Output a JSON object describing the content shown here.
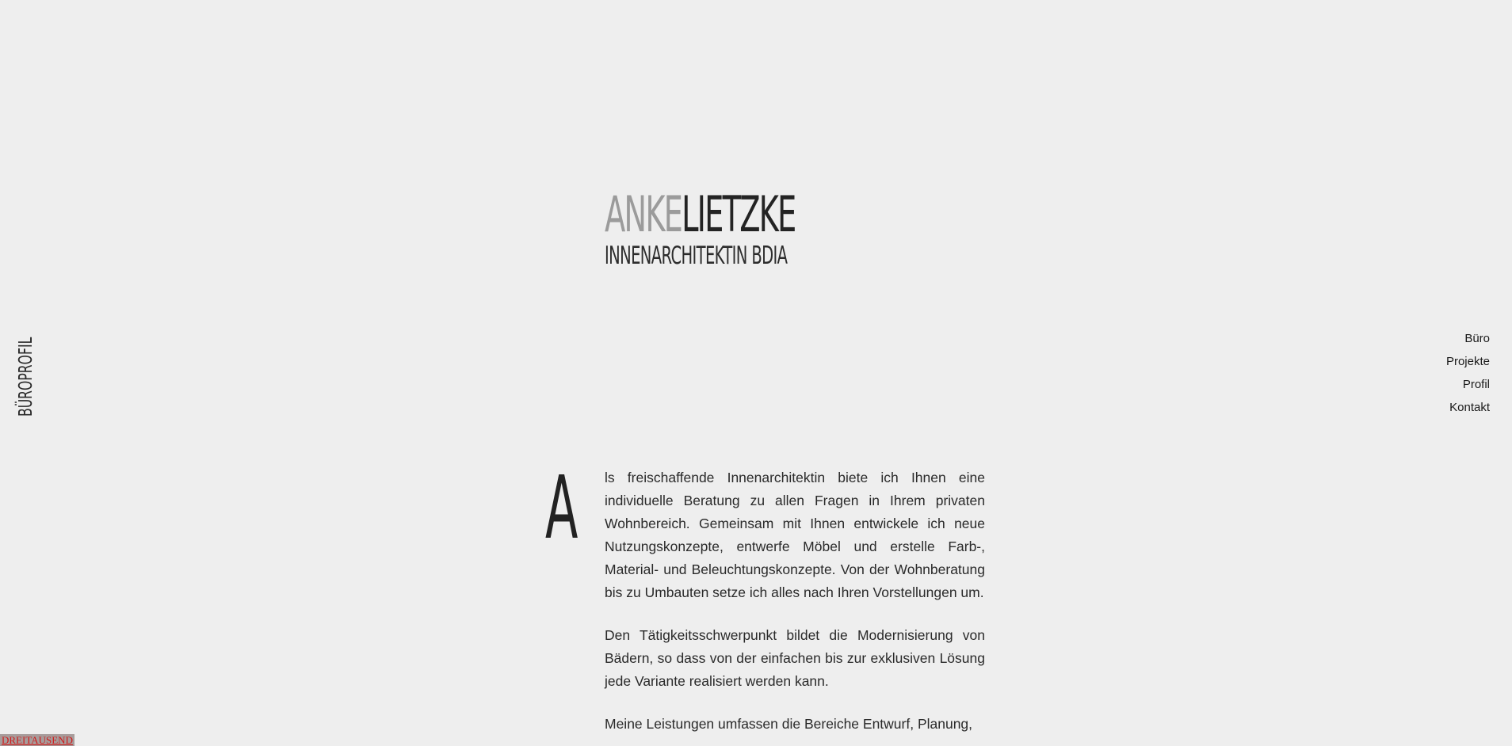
{
  "header": {
    "first_name": "ANKE",
    "last_name": "LIETZKE",
    "subtitle": "INNENARCHITEKTIN BDIA"
  },
  "side_title": "BÜROPROFIL",
  "nav": {
    "items": [
      {
        "label": "Büro"
      },
      {
        "label": "Projekte"
      },
      {
        "label": "Profil"
      },
      {
        "label": "Kontakt"
      }
    ]
  },
  "content": {
    "drop_cap": "A",
    "paragraphs": [
      "ls freischaffende Innenarchitektin biete ich Ihnen eine individuelle Beratung zu allen Fragen in Ihrem privaten Wohnbereich. Gemeinsam mit Ihnen entwickele ich neue Nutzungskonzepte, entwerfe Möbel und erstelle Farb-, Material- und Beleuchtungskonzepte. Von der Wohnberatung bis zu Umbauten setze ich alles nach Ihren Vorstellungen um.",
      "Den Tätigkeitsschwerpunkt bildet die Modernisierung von Bädern, so dass von der einfachen bis zur exklusiven Lösung jede Variante realisiert werden kann.",
      "Meine Leistungen umfassen die Bereiche Entwurf, Planung,"
    ]
  },
  "footer": {
    "credit_link": "DREITAUSEND"
  },
  "colors": {
    "background": "#eeeeee",
    "text": "#222222",
    "logo_first_name": "#9b9b9b",
    "credit_bg": "#a79c9b",
    "credit_text": "#d11b1b"
  }
}
